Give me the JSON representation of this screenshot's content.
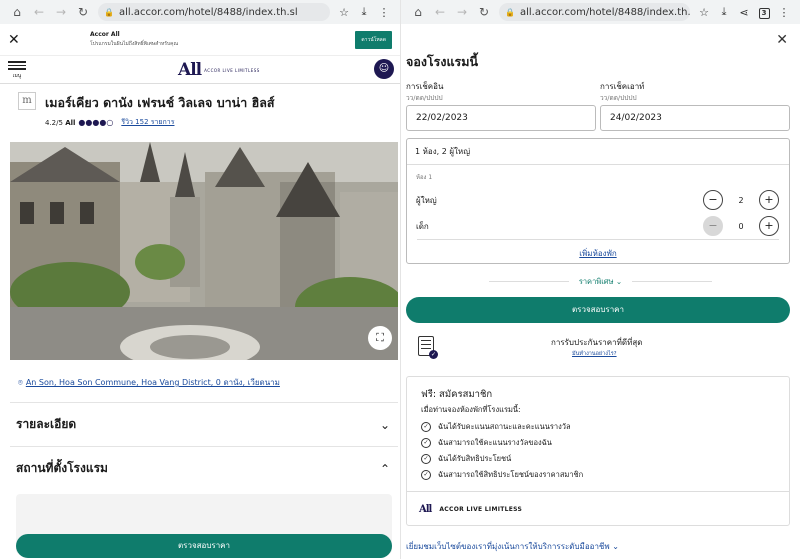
{
  "left": {
    "browser": {
      "url": "all.accor.com/hotel/8488/index.th.sl",
      "tab_count": ""
    },
    "promo": {
      "title": "Accor All",
      "subtitle": "โปรแกรมในฝันไม่ถึงสิทธิ์พิเศษสำหรับคุณ",
      "button": "ดาวน์โหลด"
    },
    "brand": {
      "menu_label": "เมนู",
      "logo": "All",
      "logo_sub": "ACCOR LIVE LIMITLESS"
    },
    "hotel": {
      "name": "เมอร์เคียว ดานัง เฟรนช์ วิลเลจ บาน่า ฮิลส์",
      "rating": "4.2/5",
      "rating_brand": "All",
      "rating_value": 4,
      "rating_max": 5,
      "reviews": "รีวิว 152 รายการ",
      "address": "An Son, Hoa Son Commune, Hoa Vang District, 0 ดานัง, เวียดนาม"
    },
    "sections": {
      "details": "รายละเอียด",
      "location": "สถานที่ตั้งโรงแรม"
    },
    "check_price": "ตรวจสอบราคา"
  },
  "right": {
    "browser": {
      "url": "all.accor.com/hotel/8488/index.th.sl",
      "tab_count": "3"
    },
    "title": "จองโรงแรมนี้",
    "checkin": {
      "label": "การเช็คอิน",
      "hint": "วว/ดด/ปปปป",
      "value": "22/02/2023"
    },
    "checkout": {
      "label": "การเช็คเอาท์",
      "hint": "วว/ดด/ปปปป",
      "value": "24/02/2023"
    },
    "guests": {
      "summary": "1 ห้อง, 2 ผู้ใหญ่",
      "room_label": "ห้อง 1",
      "adults_label": "ผู้ใหญ่",
      "adults": "2",
      "children_label": "เด็ก",
      "children": "0",
      "add_room": "เพิ่มห้องพัก"
    },
    "special_rate": "ราคาพิเศษ",
    "check_price": "ตรวจสอบราคา",
    "guarantee": {
      "title": "การรับประกันราคาที่ดีที่สุด",
      "link": "มันทำงานอย่างไร?"
    },
    "member": {
      "title": "ฟรี: สมัครสมาชิก",
      "subtitle": "เมื่อท่านจองห้องพักที่โรงแรมนี้:",
      "benefits": [
        "ฉันได้รับคะแนนสถานะและคะแนนรางวัล",
        "ฉันสามารถใช้คะแนนรางวัลของฉัน",
        "ฉันได้รับสิทธิประโยชน์",
        "ฉันสามารถใช้สิทธิประโยชน์ของราคาสมาชิก"
      ],
      "footer_logo": "All",
      "footer_text": "ACCOR LIVE LIMITLESS"
    },
    "footnote": "เยี่ยมชมเว็บไซต์ของเราที่มุ่งเน้นการให้บริการระดับมืออาชีพ"
  }
}
